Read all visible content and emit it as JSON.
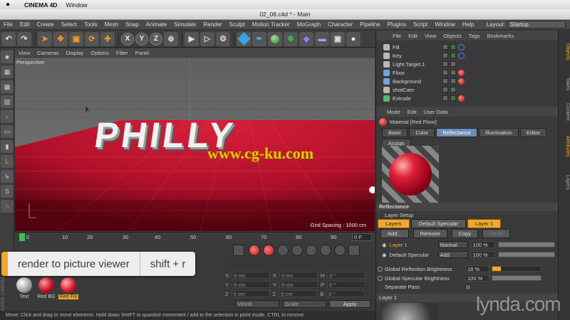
{
  "macbar": {
    "apple": "",
    "app_name": "CINEMA 4D",
    "window_menu": "Window"
  },
  "titlebar": {
    "title": "02_08.c4d * - Main"
  },
  "c4d_menu": {
    "items": [
      "File",
      "Edit",
      "Create",
      "Select",
      "Tools",
      "Mesh",
      "Snap",
      "Animate",
      "Simulate",
      "Render",
      "Sculpt",
      "Motion Tracker",
      "MoGraph",
      "Character",
      "Pipeline",
      "Plugins",
      "Script",
      "Window",
      "Help"
    ],
    "layout_label": "Layout:",
    "layout_value": "Startup"
  },
  "toolbar": {
    "axis_x": "X",
    "axis_y": "Y",
    "axis_z": "Z"
  },
  "viewport": {
    "menu": [
      "View",
      "Cameras",
      "Display",
      "Options",
      "Filter",
      "Panel"
    ],
    "label": "Perspective",
    "grid_spacing": "Grid Spacing : 1000 cm",
    "scene_text": "PHILLY",
    "watermark": "www.cg-ku.com"
  },
  "timeline": {
    "ticks": [
      "0",
      "10",
      "20",
      "30",
      "40",
      "50",
      "60",
      "70",
      "80",
      "90"
    ],
    "frame": "0 F"
  },
  "overlay": {
    "command": "render to picture viewer",
    "shortcut": "shift + r"
  },
  "materials": [
    {
      "name": "Text",
      "color": "#bdbdbd"
    },
    {
      "name": "Red BG",
      "color": "#c8102e"
    },
    {
      "name": "Red Flo",
      "color": "#d81a30"
    }
  ],
  "coords": {
    "rows": [
      {
        "a": "X",
        "av": "0 cm",
        "b": "X",
        "bv": "0 cm",
        "c": "H",
        "cv": "0 °"
      },
      {
        "a": "Y",
        "av": "0 cm",
        "b": "Y",
        "bv": "0 cm",
        "c": "P",
        "cv": "0 °"
      },
      {
        "a": "Z",
        "av": "0 cm",
        "b": "Z",
        "bv": "0 cm",
        "c": "B",
        "cv": "0 °"
      }
    ],
    "mode_world": "World",
    "mode_scale": "Scale",
    "apply": "Apply"
  },
  "status": "Move: Click and drag to move elements. Hold down SHIFT to quantize movement / add to the selection in point mode, CTRL to remove.",
  "objects_menu": [
    "File",
    "Edit",
    "View",
    "Objects",
    "Tags",
    "Bookmarks"
  ],
  "objects": [
    {
      "name": "Fill",
      "tag": "phong"
    },
    {
      "name": "Key",
      "tag": "phong"
    },
    {
      "name": "Light.Target.1",
      "tag": ""
    },
    {
      "name": "Floor",
      "tag": "ball"
    },
    {
      "name": "Background",
      "tag": "ball"
    },
    {
      "name": "shotCam",
      "tag": ""
    },
    {
      "name": "Extrude",
      "tag": "ball"
    }
  ],
  "attributes": {
    "menu": [
      "Mode",
      "Edit",
      "User Data"
    ],
    "title": "Material [Red Floor]",
    "tabs": [
      "Basic",
      "Color",
      "Reflectance",
      "Illumination",
      "Editor",
      "Assign"
    ],
    "active_tab": "Reflectance",
    "section": "Reflectance",
    "layer_setup": "Layer Setup",
    "layer_tabs": [
      "Layers",
      "Default Specular",
      "Layer 1"
    ],
    "buttons": [
      "Add...",
      "Remove",
      "Copy",
      "Paste"
    ],
    "layers": [
      {
        "name": "Layer 1",
        "mode": "Normal",
        "pct": "100 %",
        "value": 1.0
      },
      {
        "name": "Default Specular",
        "mode": "Add",
        "pct": "100 %",
        "value": 1.0
      }
    ],
    "brightness": [
      {
        "name": "Global Reflection Brightness",
        "pct": "18 %",
        "value": 0.18
      },
      {
        "name": "Global Specular Brightness",
        "pct": "100 %",
        "value": 1.0
      }
    ],
    "separate_pass": "Separate Pass",
    "layer_section": "Layer 1"
  },
  "side_tabs": [
    "Objects",
    "Takes",
    "Content",
    "Attributes",
    "Layers"
  ],
  "branding": {
    "lynda": "lynda.com",
    "maxon": "MAXON CINEMA"
  }
}
